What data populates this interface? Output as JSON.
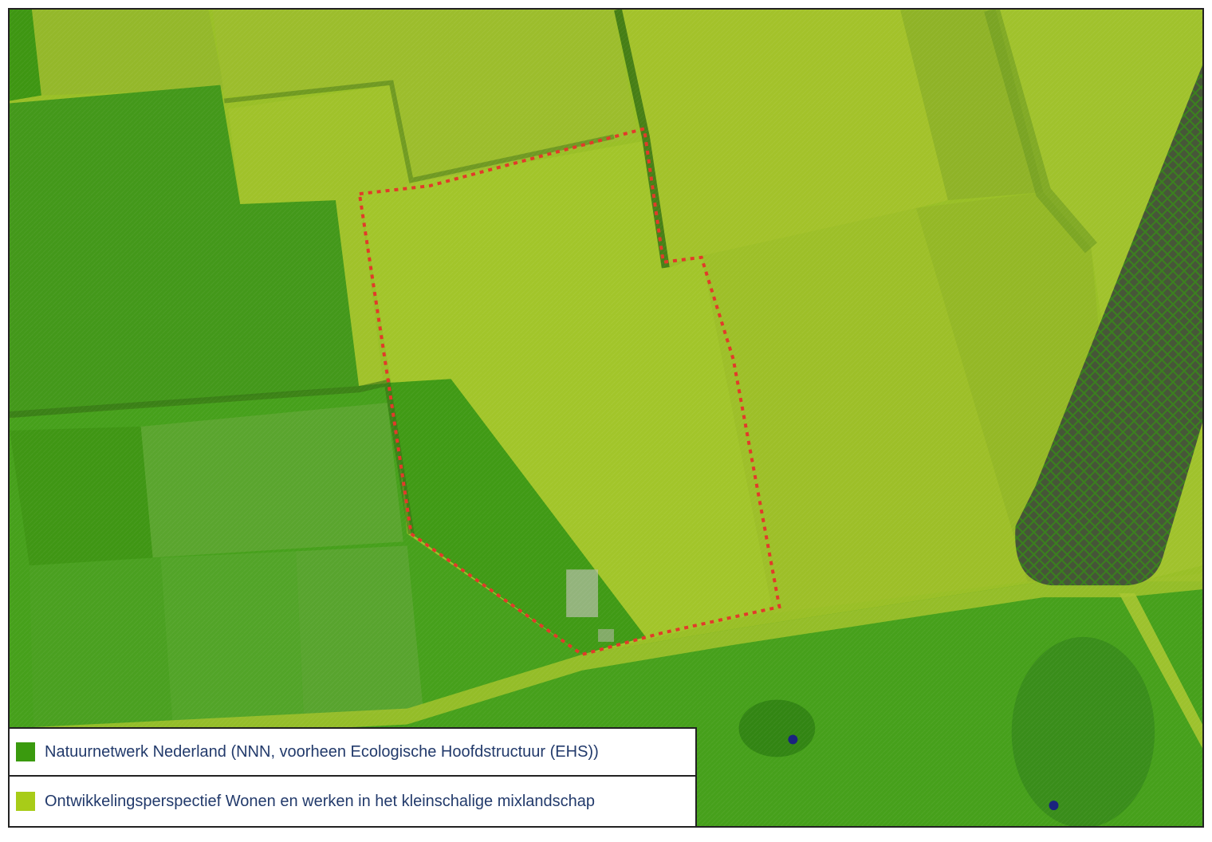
{
  "map": {
    "layers": [
      {
        "name": "natuurnetwerk",
        "color": "#3f9a12"
      },
      {
        "name": "mixlandschap",
        "color": "#9cc412"
      }
    ],
    "site_boundary_color": "#e23a2a",
    "hatch_color": "#5a6a5a",
    "point_color": "#1a237e"
  },
  "legend": {
    "items": [
      {
        "label": "Natuurnetwerk Nederland (NNN, voorheen Ecologische Hoofdstructuur (EHS))",
        "color": "#3a9a0e"
      },
      {
        "label": "Ontwikkelingsperspectief Wonen en werken in het kleinschalige mixlandschap",
        "color": "#a8cc18"
      }
    ]
  }
}
